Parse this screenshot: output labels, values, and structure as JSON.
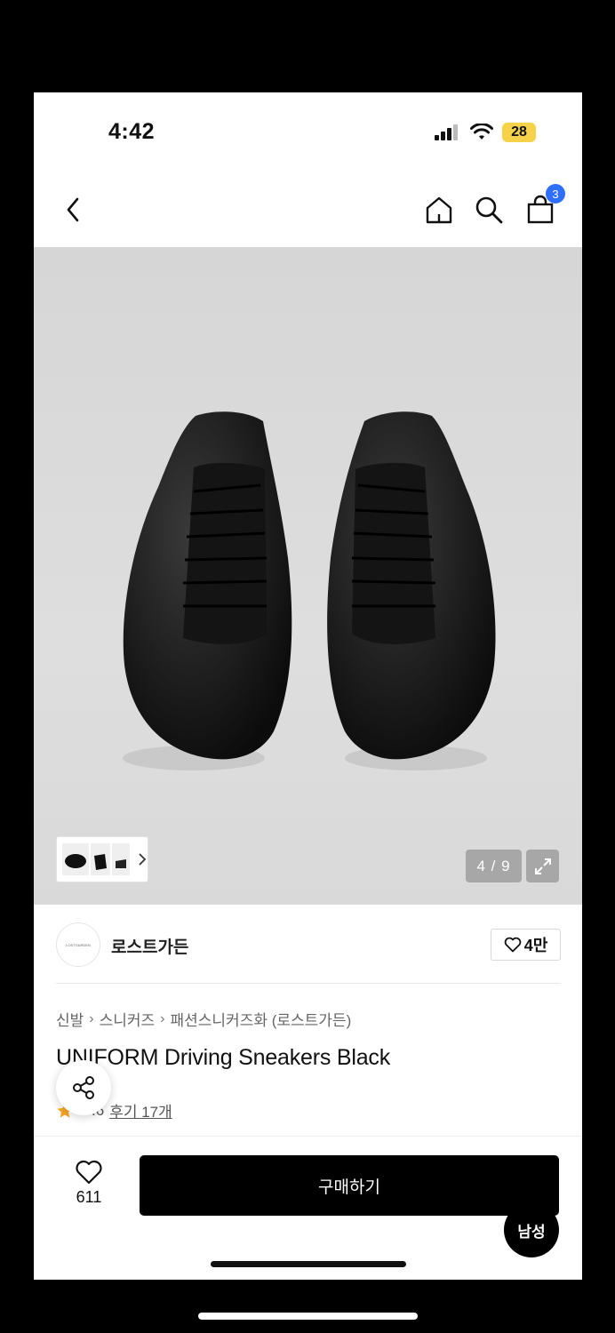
{
  "status_bar": {
    "time": "4:42",
    "battery": "28"
  },
  "nav": {
    "cart_count": "3"
  },
  "gallery": {
    "page_indicator": "4 / 9"
  },
  "brand": {
    "logo_text": "LOSTGARDEN",
    "name": "로스트가든",
    "likes": "4만"
  },
  "breadcrumb": [
    "신발",
    "스니커즈",
    "패션스니커즈화 (로스트가든)"
  ],
  "product": {
    "title": "UNIFORM Driving Sneakers Black",
    "rating": ".6",
    "review_link": "후기 17개"
  },
  "bottom_bar": {
    "wish_count": "611",
    "buy_label": "구매하기",
    "gender_chip": "남성"
  },
  "colors": {
    "accent_badge": "#2f6fff",
    "star": "#f5a623"
  }
}
